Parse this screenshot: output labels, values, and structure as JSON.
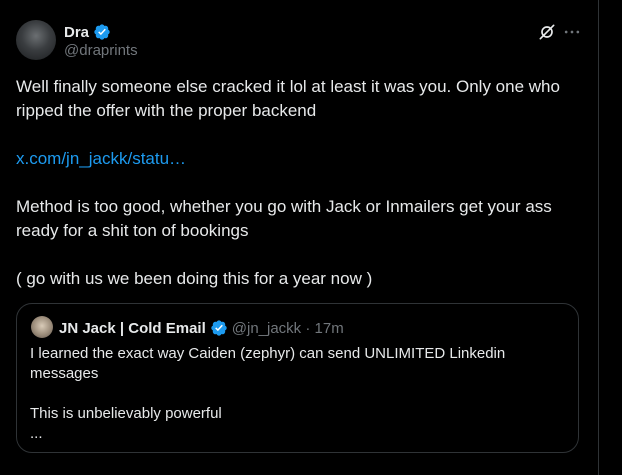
{
  "author": {
    "name": "Dra",
    "handle": "@draprints"
  },
  "post": {
    "line1": "Well finally someone else cracked it lol at least it was you. Only one who ripped the offer with the proper backend",
    "link_text": "x.com/jn_jackk/statu…",
    "line2": "Method is too good, whether you go with Jack or Inmailers get your ass ready for a shit ton of bookings",
    "line3": "( go with us we been doing this for a year now )"
  },
  "quote": {
    "name": "JN Jack | Cold Email",
    "handle_time": "@jn_jackk · 17m",
    "text1": "I learned the exact way Caiden (zephyr) can send UNLIMITED Linkedin messages",
    "text2": "This is unbelievably powerful",
    "text3": "..."
  },
  "icons": {
    "verified": "verified-badge-icon",
    "grok": "grok-icon",
    "more": "more-options-icon"
  },
  "colors": {
    "background": "#000000",
    "text": "#e7e9ea",
    "muted": "#71767b",
    "link": "#1d9bf0",
    "verified": "#1d9bf0",
    "border": "#2f3336"
  }
}
